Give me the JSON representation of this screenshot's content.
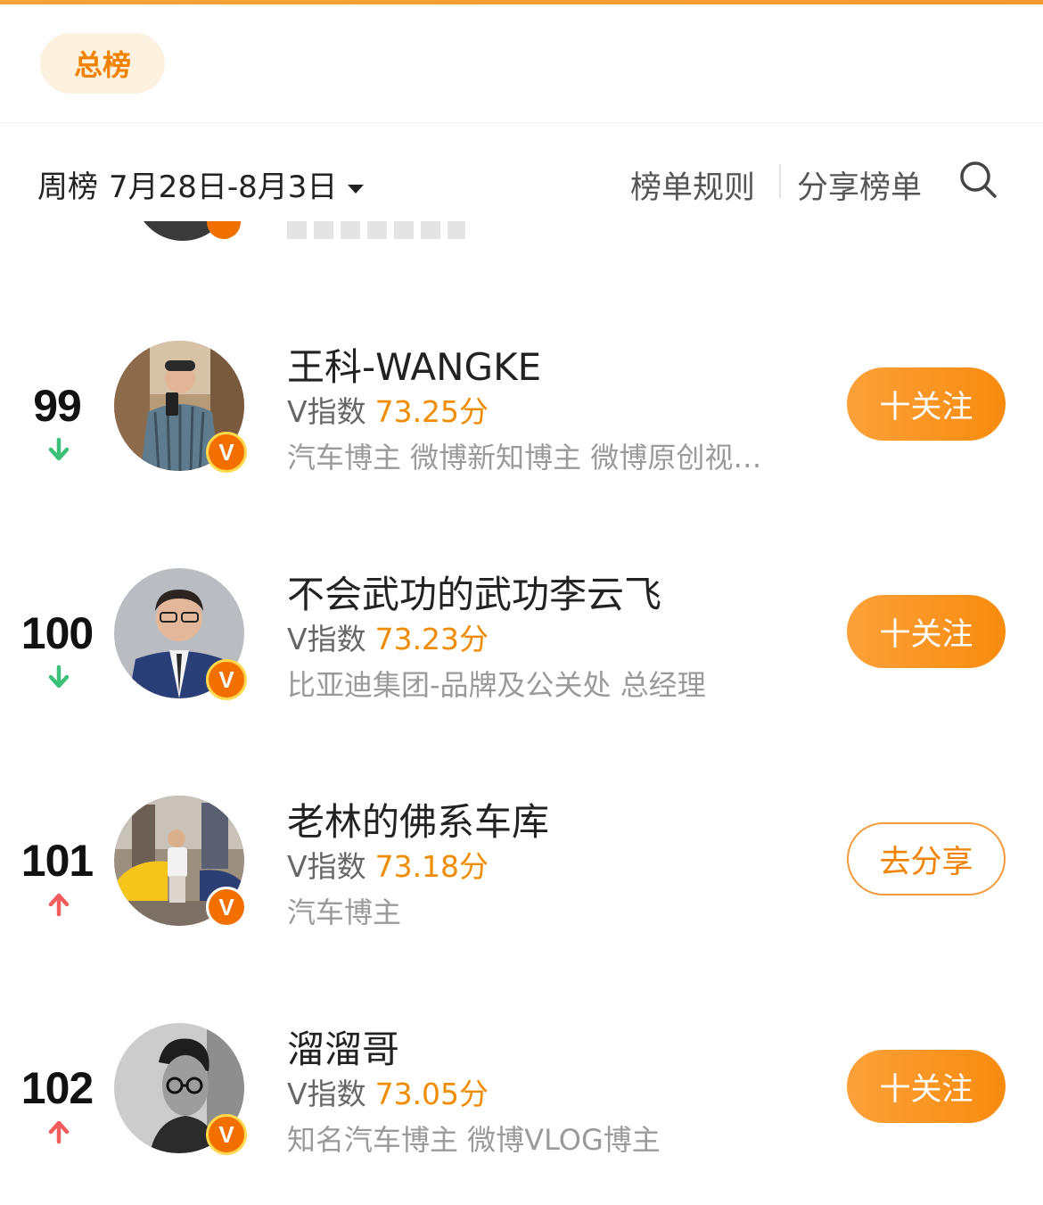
{
  "tabs": {
    "active_label": "总榜"
  },
  "filter": {
    "period_label": "周榜",
    "date_range": "7月28日-8月3日",
    "rules_label": "榜单规则",
    "share_label": "分享榜单"
  },
  "score_prefix": "V指数",
  "rows": [
    {
      "rank": "99",
      "trend": "down",
      "name": "王科-WANGKE",
      "score": "73.25分",
      "description": "汽车博主 微博新知博主 微博原创视…",
      "action": "十关注",
      "action_type": "follow"
    },
    {
      "rank": "100",
      "trend": "down",
      "name": "不会武功的武功李云飞",
      "score": "73.23分",
      "description": "比亚迪集团-品牌及公关处 总经理",
      "action": "十关注",
      "action_type": "follow"
    },
    {
      "rank": "101",
      "trend": "up",
      "name": "老林的佛系车库",
      "score": "73.18分",
      "description": "汽车博主",
      "action": "去分享",
      "action_type": "share"
    },
    {
      "rank": "102",
      "trend": "up",
      "name": "溜溜哥",
      "score": "73.05分",
      "description": "知名汽车博主 微博VLOG博主",
      "action": "十关注",
      "action_type": "follow"
    }
  ],
  "colors": {
    "accent_orange": "#f08c00",
    "follow_button": "#f88b0e",
    "trend_up": "#f25c5c",
    "trend_down": "#3cc07a",
    "verified_badge": "#f37000"
  },
  "icons": {
    "search": "search-icon",
    "trend_up": "arrow-up-icon",
    "trend_down": "arrow-down-icon",
    "verified": "verified-v-badge-icon"
  }
}
